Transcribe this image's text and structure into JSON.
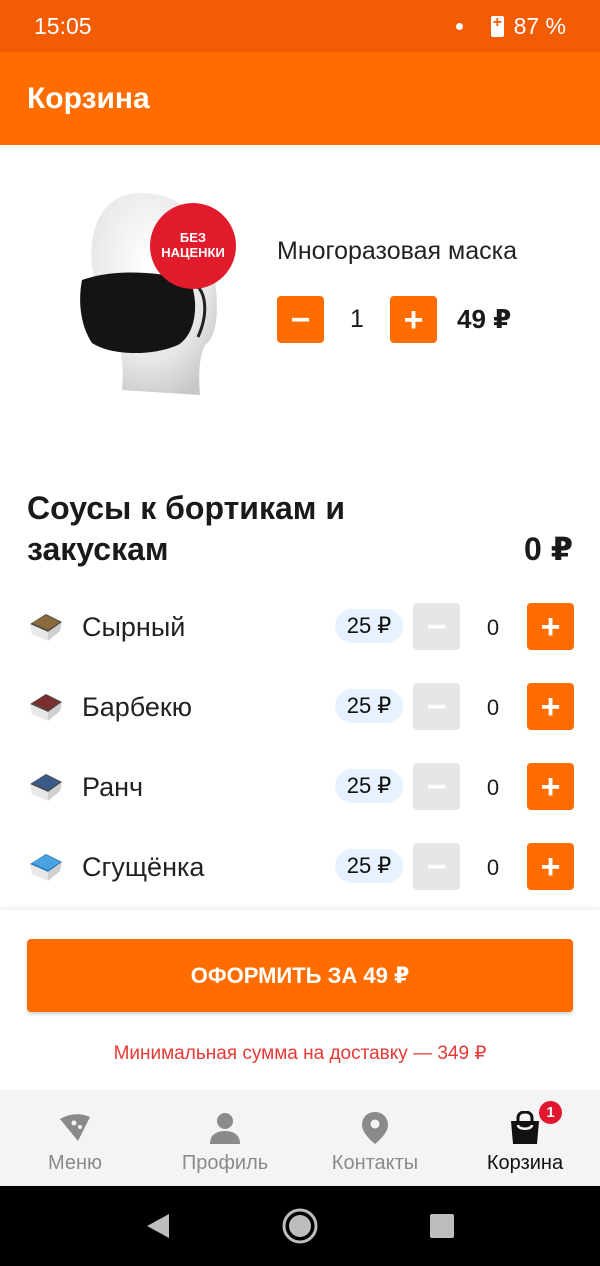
{
  "status_bar": {
    "time": "15:05",
    "battery": "87 %"
  },
  "app_bar": {
    "title": "Корзина"
  },
  "product": {
    "badge": "БЕЗ\nНАЦЕНКИ",
    "name": "Многоразовая маска",
    "quantity": "1",
    "price": "49 ₽",
    "minus": "−",
    "plus": "+"
  },
  "sauces": {
    "title": "Соусы к бортикам и закускам",
    "total": "0 ₽",
    "items": [
      {
        "name": "Сырный",
        "price": "25 ₽",
        "qty": "0",
        "cup_color": "#8a6a3a"
      },
      {
        "name": "Барбекю",
        "price": "25 ₽",
        "qty": "0",
        "cup_color": "#7a2e2e"
      },
      {
        "name": "Ранч",
        "price": "25 ₽",
        "qty": "0",
        "cup_color": "#3a5a8a"
      },
      {
        "name": "Сгущёнка",
        "price": "25 ₽",
        "qty": "0",
        "cup_color": "#4aa3e0"
      }
    ]
  },
  "checkout": {
    "button": "ОФОРМИТЬ ЗА 49 ₽",
    "min_note": "Минимальная сумма на доставку — 349 ₽"
  },
  "bottom_nav": {
    "items": [
      {
        "label": "Меню",
        "icon": "pizza-slice-icon"
      },
      {
        "label": "Профиль",
        "icon": "person-icon"
      },
      {
        "label": "Контакты",
        "icon": "location-pin-icon"
      },
      {
        "label": "Корзина",
        "icon": "shopping-bag-icon",
        "badge": "1"
      }
    ],
    "active": "Корзина"
  },
  "colors": {
    "accent": "#ff6d00",
    "status": "#f25c05",
    "badge_red": "#e11b2c",
    "warning": "#e53935"
  }
}
